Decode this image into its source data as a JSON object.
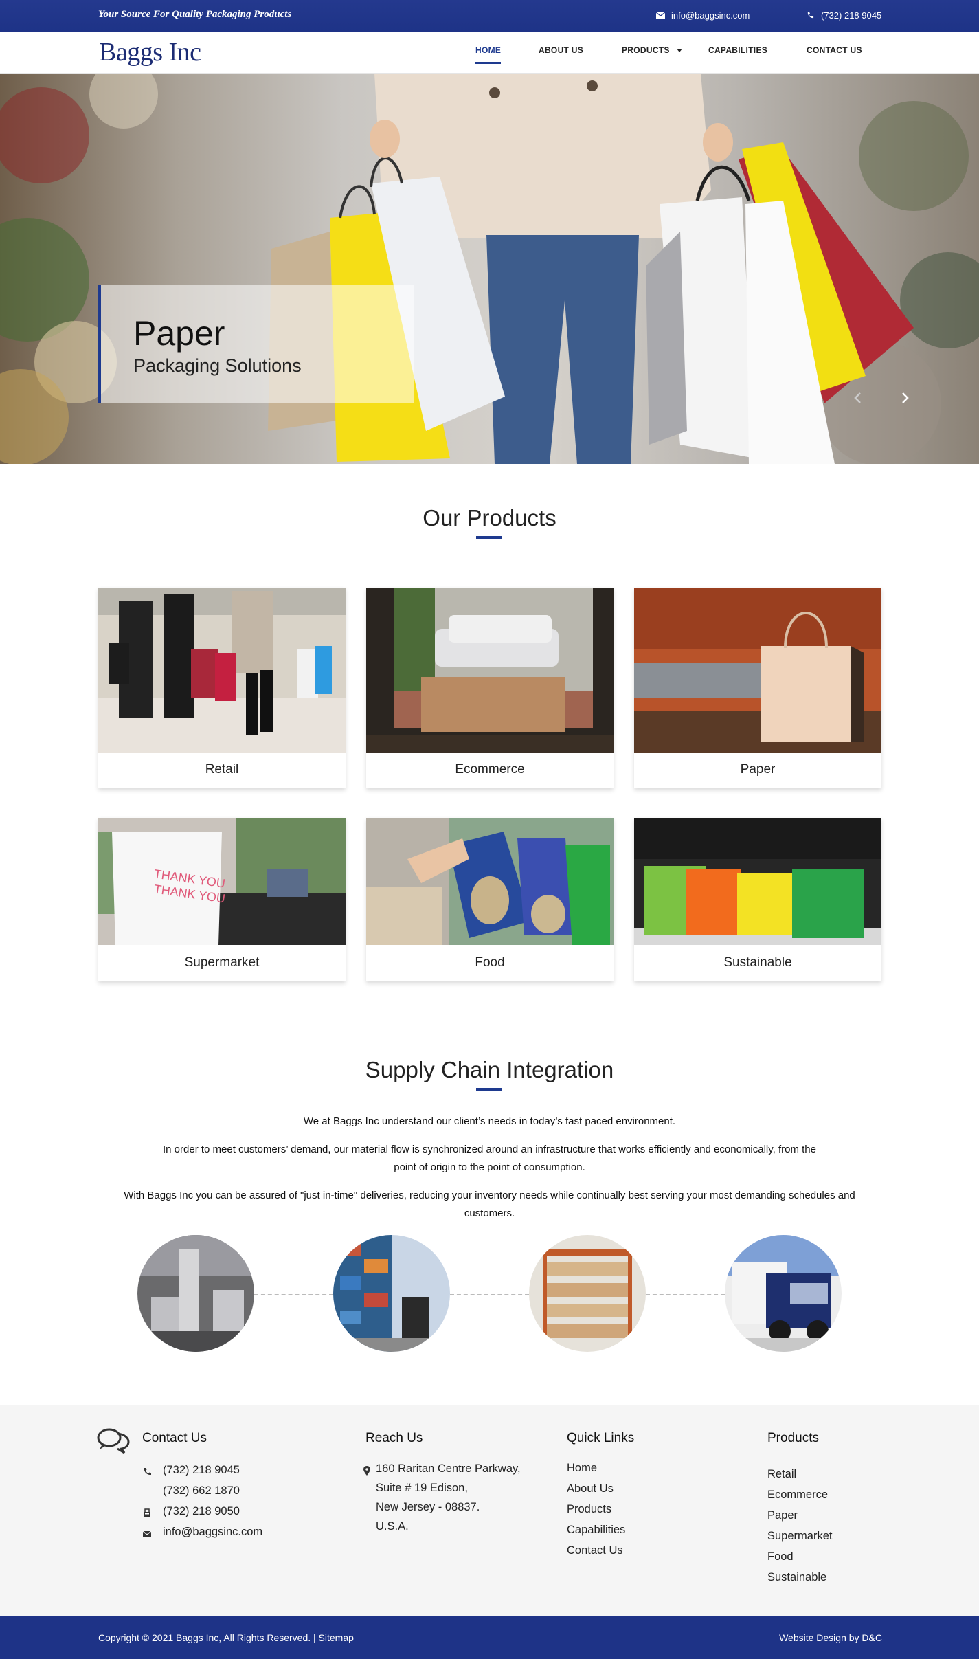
{
  "topbar": {
    "tagline": "Your Source For Quality Packaging Products",
    "email": "info@baggsinc.com",
    "phone": "(732) 218 9045"
  },
  "brand": {
    "logo": "Baggs Inc"
  },
  "nav": {
    "items": [
      {
        "label": "HOME",
        "active": true
      },
      {
        "label": "ABOUT US"
      },
      {
        "label": "PRODUCTS",
        "dropdown": true
      },
      {
        "label": "CAPABILITIES"
      },
      {
        "label": "CONTACT US"
      }
    ]
  },
  "hero": {
    "title": "Paper",
    "subtitle": "Packaging Solutions",
    "prev_icon": "chevron-left-icon",
    "next_icon": "chevron-right-icon"
  },
  "products": {
    "heading": "Our Products",
    "cards": [
      {
        "label": "Retail"
      },
      {
        "label": "Ecommerce"
      },
      {
        "label": "Paper"
      },
      {
        "label": "Supermarket"
      },
      {
        "label": "Food"
      },
      {
        "label": "Sustainable"
      }
    ]
  },
  "supply": {
    "heading": "Supply Chain Integration",
    "paragraphs": [
      "We at Baggs Inc understand our client’s needs in today’s fast paced environment.",
      "In order to meet customers’ demand, our material flow is synchronized around an infrastructure that works efficiently and economically, from the point of origin to the point of consumption.",
      "With Baggs Inc you can be assured of \"just in-time\" deliveries, reducing your inventory needs while continually best serving your most demanding schedules and customers."
    ]
  },
  "footer": {
    "contact": {
      "heading": "Contact Us",
      "phone1": "(732) 218 9045",
      "phone2": "(732) 662 1870",
      "fax": "(732) 218 9050",
      "email": "info@baggsinc.com"
    },
    "reach": {
      "heading": "Reach Us",
      "lines": [
        "160 Raritan Centre Parkway,",
        "Suite # 19 Edison,",
        "New Jersey - 08837.",
        "U.S.A."
      ]
    },
    "quick_links": {
      "heading": "Quick Links",
      "items": [
        "Home",
        "About Us",
        "Products",
        "Capabilities",
        "Contact Us"
      ]
    },
    "products": {
      "heading": "Products",
      "items": [
        "Retail",
        "Ecommerce",
        "Paper",
        "Supermarket",
        "Food",
        "Sustainable"
      ]
    }
  },
  "bottombar": {
    "copyright": "Copyright © 2021 Baggs Inc, All Rights Reserved. | Sitemap",
    "credit": "Website Design by D&C"
  },
  "colors": {
    "brand_blue": "#1e3387",
    "accent": "#1e3a8f",
    "footer_bg": "#f5f5f5"
  }
}
